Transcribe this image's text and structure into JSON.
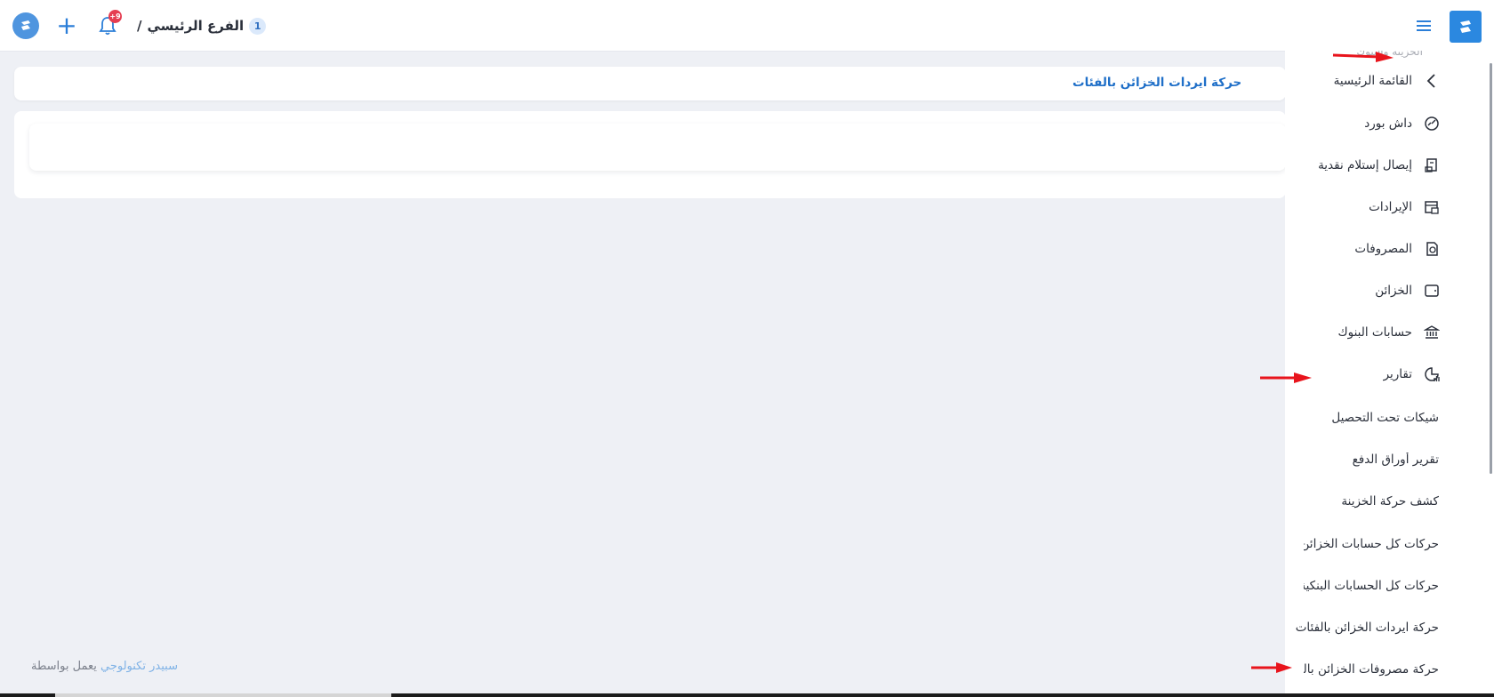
{
  "header": {
    "branch_label": "الفرع الرئيسي",
    "branch_separator": "/",
    "branch_number": "1",
    "notification_badge": "+9",
    "add_symbol": "+"
  },
  "page": {
    "title": "حركة ايردات الخزائن بالفئات"
  },
  "footer": {
    "powered_by": "يعمل بواسطة",
    "company": "سبيدر تكنولوجي"
  },
  "sidebar": {
    "faded_label": "الخزينة والبنوك",
    "back_item": "القائمة الرئيسية",
    "items": [
      {
        "label": "داش بورد",
        "icon": "dashboard-icon"
      },
      {
        "label": "إيصال إستلام نقدية",
        "icon": "receipt-icon"
      },
      {
        "label": "الإيرادات",
        "icon": "revenue-icon"
      },
      {
        "label": "المصروفات",
        "icon": "expenses-icon"
      },
      {
        "label": "الخزائن",
        "icon": "wallet-icon"
      },
      {
        "label": "حسابات البنوك",
        "icon": "bank-icon"
      },
      {
        "label": "تقارير",
        "icon": "reports-icon"
      }
    ],
    "sub_items": [
      "شيكات تحت التحصيل",
      "تقرير أوراق الدفع",
      "كشف حركة الخزينة",
      "حركات كل حسابات الخزائن",
      "حركات كل الحسابات البنكية",
      "حركة ايردات الخزائن بالفئات",
      "حركة مصروفات الخزائن بالفئات"
    ]
  },
  "colors": {
    "accent": "#2b88e0",
    "title": "#1f6fc8",
    "badge": "#e53e52",
    "arrow": "#e8141c"
  }
}
